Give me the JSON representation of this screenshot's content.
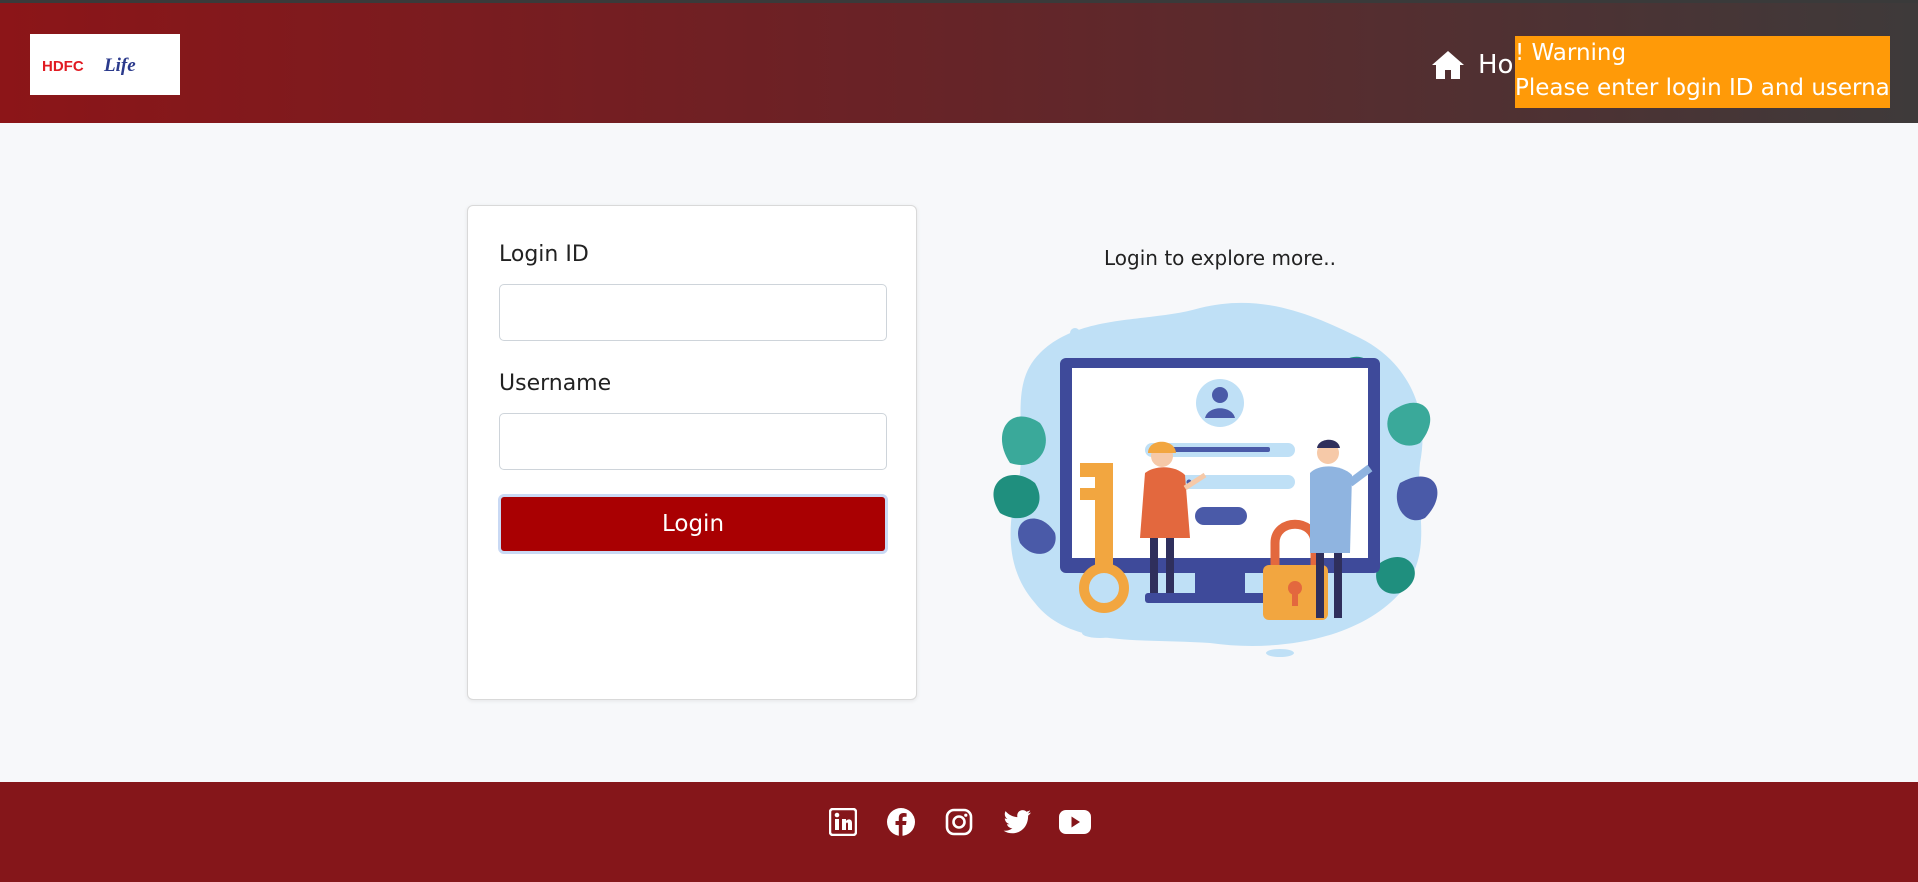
{
  "header": {
    "logo_alt": "HDFC Life",
    "home_label": "Ho"
  },
  "toast": {
    "title": "! Warning",
    "message": "Please enter login ID and username",
    "color": "#ff9a08"
  },
  "form": {
    "login_id_label": "Login ID",
    "login_id_value": "",
    "username_label": "Username",
    "username_value": "",
    "submit_label": "Login"
  },
  "illustration": {
    "tagline": "Login to explore more.."
  },
  "footer": {
    "social_icons": [
      "linkedin-icon",
      "facebook-icon",
      "instagram-icon",
      "twitter-icon",
      "youtube-icon"
    ]
  },
  "colors": {
    "brand_red": "#a90002",
    "footer_red": "#85161a"
  }
}
